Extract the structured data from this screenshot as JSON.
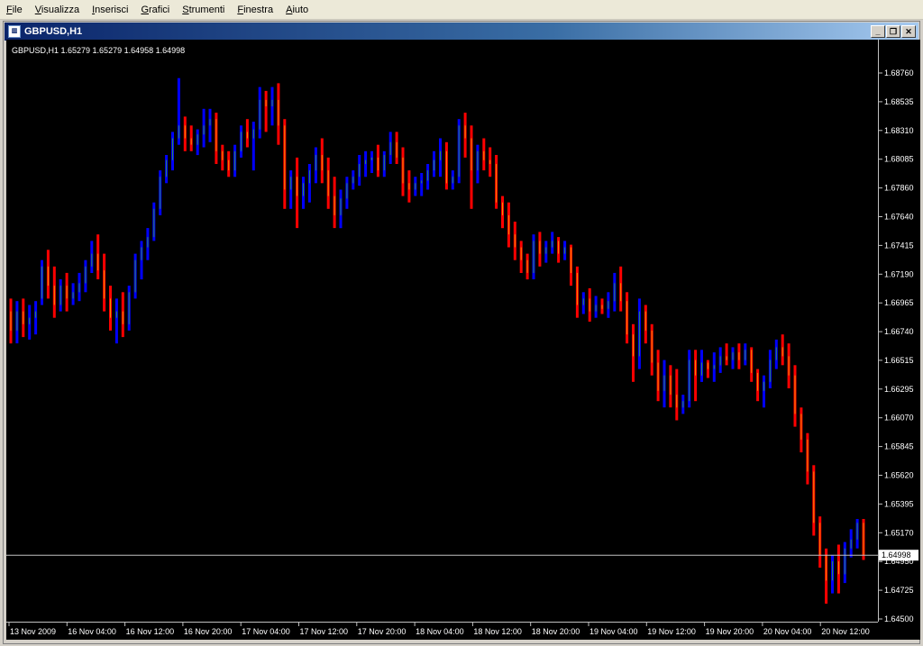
{
  "menu": {
    "items": [
      "File",
      "Visualizza",
      "Inserisci",
      "Grafici",
      "Strumenti",
      "Finestra",
      "Aiuto"
    ]
  },
  "window": {
    "title": "GBPUSD,H1",
    "icon": "chart-window-icon",
    "controls": [
      "minimize-icon",
      "restore-icon",
      "close-icon"
    ]
  },
  "colors": {
    "background": "#000000",
    "axis": "#c0c0c0",
    "label": "#ffffff",
    "bull_bar": "#0000ff",
    "bear_bar": "#ff0000",
    "bull_body": "#2e8b57",
    "bear_body": "#ff8c00",
    "bid_line": "#c0c0c0"
  },
  "chart_data": {
    "type": "bar",
    "symbol": "GBPUSD,H1",
    "info_line": "GBPUSD,H1  1.65279 1.65279 1.64958 1.64998",
    "current_price": "1.64998",
    "ylim": [
      1.645,
      1.69
    ],
    "y_ticks": [
      "1.68760",
      "1.68535",
      "1.68310",
      "1.68085",
      "1.67860",
      "1.67640",
      "1.67415",
      "1.67190",
      "1.66965",
      "1.66740",
      "1.66515",
      "1.66295",
      "1.66070",
      "1.65845",
      "1.65620",
      "1.65395",
      "1.65170",
      "1.64950",
      "1.64725",
      "1.64500"
    ],
    "x_ticks": [
      "13 Nov 2009",
      "16 Nov 04:00",
      "16 Nov 12:00",
      "16 Nov 20:00",
      "17 Nov 04:00",
      "17 Nov 12:00",
      "17 Nov 20:00",
      "18 Nov 04:00",
      "18 Nov 12:00",
      "18 Nov 20:00",
      "19 Nov 04:00",
      "19 Nov 12:00",
      "19 Nov 20:00",
      "20 Nov 04:00",
      "20 Nov 12:00"
    ],
    "bars": [
      [
        1.669,
        1.67,
        1.6665,
        1.6675
      ],
      [
        1.6675,
        1.6698,
        1.6665,
        1.669
      ],
      [
        1.669,
        1.67,
        1.667,
        1.668
      ],
      [
        1.668,
        1.6695,
        1.6668,
        1.6685
      ],
      [
        1.6685,
        1.6698,
        1.6672,
        1.669
      ],
      [
        1.67,
        1.673,
        1.6695,
        1.6725
      ],
      [
        1.6725,
        1.6738,
        1.67,
        1.671
      ],
      [
        1.671,
        1.6725,
        1.6685,
        1.6695
      ],
      [
        1.6695,
        1.6715,
        1.669,
        1.671
      ],
      [
        1.671,
        1.672,
        1.669,
        1.67
      ],
      [
        1.67,
        1.6712,
        1.6695,
        1.6705
      ],
      [
        1.6705,
        1.672,
        1.6698,
        1.6712
      ],
      [
        1.6712,
        1.673,
        1.6705,
        1.6725
      ],
      [
        1.6725,
        1.6745,
        1.672,
        1.6735
      ],
      [
        1.6735,
        1.675,
        1.6715,
        1.6722
      ],
      [
        1.6722,
        1.6735,
        1.669,
        1.67
      ],
      [
        1.67,
        1.671,
        1.6675,
        1.6685
      ],
      [
        1.6685,
        1.67,
        1.6665,
        1.669
      ],
      [
        1.669,
        1.6705,
        1.667,
        1.668
      ],
      [
        1.668,
        1.671,
        1.6675,
        1.6705
      ],
      [
        1.6705,
        1.6735,
        1.67,
        1.673
      ],
      [
        1.673,
        1.6745,
        1.6715,
        1.674
      ],
      [
        1.674,
        1.6755,
        1.673,
        1.6748
      ],
      [
        1.6748,
        1.6775,
        1.6745,
        1.677
      ],
      [
        1.677,
        1.68,
        1.6765,
        1.6795
      ],
      [
        1.6795,
        1.6812,
        1.679,
        1.6808
      ],
      [
        1.6808,
        1.683,
        1.68,
        1.6825
      ],
      [
        1.6825,
        1.6872,
        1.682,
        1.6835
      ],
      [
        1.6835,
        1.6842,
        1.6815,
        1.6825
      ],
      [
        1.6825,
        1.6835,
        1.6815,
        1.682
      ],
      [
        1.682,
        1.6832,
        1.6812,
        1.6828
      ],
      [
        1.6828,
        1.6848,
        1.6818,
        1.6835
      ],
      [
        1.6835,
        1.6848,
        1.6822,
        1.684
      ],
      [
        1.684,
        1.6845,
        1.6805,
        1.6815
      ],
      [
        1.6815,
        1.682,
        1.68,
        1.6808
      ],
      [
        1.6808,
        1.6815,
        1.6795,
        1.68
      ],
      [
        1.68,
        1.682,
        1.6795,
        1.6815
      ],
      [
        1.6815,
        1.6835,
        1.681,
        1.683
      ],
      [
        1.683,
        1.684,
        1.6818,
        1.6825
      ],
      [
        1.6825,
        1.6838,
        1.68,
        1.6832
      ],
      [
        1.6832,
        1.6865,
        1.6825,
        1.6855
      ],
      [
        1.6855,
        1.6862,
        1.683,
        1.685
      ],
      [
        1.685,
        1.6865,
        1.6835,
        1.6855
      ],
      [
        1.6855,
        1.6868,
        1.682,
        1.6835
      ],
      [
        1.6835,
        1.684,
        1.677,
        1.6785
      ],
      [
        1.6785,
        1.68,
        1.677,
        1.6795
      ],
      [
        1.6795,
        1.681,
        1.6755,
        1.678
      ],
      [
        1.678,
        1.6795,
        1.677,
        1.679
      ],
      [
        1.679,
        1.6805,
        1.6775,
        1.68
      ],
      [
        1.68,
        1.6818,
        1.679,
        1.6812
      ],
      [
        1.6812,
        1.6825,
        1.679,
        1.68
      ],
      [
        1.68,
        1.681,
        1.677,
        1.678
      ],
      [
        1.678,
        1.6795,
        1.6755,
        1.6765
      ],
      [
        1.6765,
        1.6785,
        1.6755,
        1.6778
      ],
      [
        1.6778,
        1.6795,
        1.677,
        1.679
      ],
      [
        1.679,
        1.68,
        1.6785,
        1.6795
      ],
      [
        1.6795,
        1.6812,
        1.6788,
        1.6805
      ],
      [
        1.6805,
        1.6815,
        1.6795,
        1.6808
      ],
      [
        1.6808,
        1.6815,
        1.6798,
        1.681
      ],
      [
        1.681,
        1.682,
        1.6795,
        1.68
      ],
      [
        1.68,
        1.6815,
        1.6795,
        1.6812
      ],
      [
        1.6812,
        1.683,
        1.6805,
        1.6822
      ],
      [
        1.6822,
        1.683,
        1.6805,
        1.681
      ],
      [
        1.681,
        1.6818,
        1.678,
        1.679
      ],
      [
        1.679,
        1.68,
        1.6775,
        1.6785
      ],
      [
        1.6785,
        1.6795,
        1.678,
        1.679
      ],
      [
        1.679,
        1.6798,
        1.678,
        1.6792
      ],
      [
        1.6792,
        1.6805,
        1.6785,
        1.68
      ],
      [
        1.68,
        1.6815,
        1.6795,
        1.6808
      ],
      [
        1.6808,
        1.6825,
        1.6795,
        1.6815
      ],
      [
        1.6815,
        1.6822,
        1.6785,
        1.679
      ],
      [
        1.679,
        1.68,
        1.6785,
        1.6795
      ],
      [
        1.6795,
        1.684,
        1.679,
        1.6835
      ],
      [
        1.6835,
        1.6845,
        1.681,
        1.6825
      ],
      [
        1.6825,
        1.6835,
        1.677,
        1.68
      ],
      [
        1.68,
        1.682,
        1.679,
        1.6815
      ],
      [
        1.6815,
        1.6825,
        1.68,
        1.6808
      ],
      [
        1.6808,
        1.6818,
        1.6795,
        1.6805
      ],
      [
        1.6805,
        1.6812,
        1.677,
        1.6775
      ],
      [
        1.6775,
        1.678,
        1.6755,
        1.6765
      ],
      [
        1.6765,
        1.6775,
        1.674,
        1.675
      ],
      [
        1.675,
        1.676,
        1.673,
        1.674
      ],
      [
        1.674,
        1.6745,
        1.672,
        1.673
      ],
      [
        1.673,
        1.6735,
        1.6715,
        1.672
      ],
      [
        1.672,
        1.675,
        1.6715,
        1.6745
      ],
      [
        1.6745,
        1.6752,
        1.6725,
        1.6735
      ],
      [
        1.6735,
        1.6745,
        1.6728,
        1.674
      ],
      [
        1.674,
        1.6752,
        1.6735,
        1.6745
      ],
      [
        1.6745,
        1.6748,
        1.6728,
        1.6735
      ],
      [
        1.6735,
        1.6745,
        1.673,
        1.674
      ],
      [
        1.674,
        1.6742,
        1.671,
        1.672
      ],
      [
        1.672,
        1.6725,
        1.6685,
        1.6695
      ],
      [
        1.6695,
        1.6705,
        1.6688,
        1.67
      ],
      [
        1.67,
        1.6708,
        1.6682,
        1.669
      ],
      [
        1.669,
        1.6702,
        1.6685,
        1.6695
      ],
      [
        1.6695,
        1.67,
        1.6688,
        1.6692
      ],
      [
        1.6692,
        1.6705,
        1.6685,
        1.6698
      ],
      [
        1.6698,
        1.672,
        1.669,
        1.6712
      ],
      [
        1.6712,
        1.6725,
        1.669,
        1.6698
      ],
      [
        1.6698,
        1.6705,
        1.6665,
        1.6672
      ],
      [
        1.6672,
        1.668,
        1.6635,
        1.6655
      ],
      [
        1.6655,
        1.67,
        1.6645,
        1.669
      ],
      [
        1.669,
        1.6695,
        1.6665,
        1.6675
      ],
      [
        1.6675,
        1.668,
        1.664,
        1.665
      ],
      [
        1.665,
        1.666,
        1.662,
        1.6628
      ],
      [
        1.6628,
        1.6652,
        1.6615,
        1.664
      ],
      [
        1.664,
        1.6648,
        1.6615,
        1.6625
      ],
      [
        1.6625,
        1.6645,
        1.6605,
        1.6615
      ],
      [
        1.6615,
        1.6625,
        1.661,
        1.662
      ],
      [
        1.662,
        1.666,
        1.6615,
        1.6652
      ],
      [
        1.6652,
        1.666,
        1.662,
        1.664
      ],
      [
        1.664,
        1.666,
        1.6635,
        1.665
      ],
      [
        1.665,
        1.6652,
        1.6638,
        1.6645
      ],
      [
        1.6645,
        1.6658,
        1.6635,
        1.6648
      ],
      [
        1.6648,
        1.6662,
        1.6642,
        1.6655
      ],
      [
        1.6655,
        1.6665,
        1.6648,
        1.6652
      ],
      [
        1.6652,
        1.6662,
        1.6645,
        1.6658
      ],
      [
        1.6658,
        1.6665,
        1.6645,
        1.6652
      ],
      [
        1.6652,
        1.6665,
        1.6648,
        1.666
      ],
      [
        1.666,
        1.6662,
        1.6635,
        1.6642
      ],
      [
        1.6642,
        1.6645,
        1.662,
        1.6628
      ],
      [
        1.6628,
        1.664,
        1.6615,
        1.6635
      ],
      [
        1.6635,
        1.666,
        1.663,
        1.6652
      ],
      [
        1.6652,
        1.6668,
        1.6645,
        1.6662
      ],
      [
        1.6662,
        1.6672,
        1.6648,
        1.6655
      ],
      [
        1.6655,
        1.6665,
        1.663,
        1.664
      ],
      [
        1.664,
        1.6648,
        1.66,
        1.661
      ],
      [
        1.661,
        1.6615,
        1.658,
        1.659
      ],
      [
        1.659,
        1.6595,
        1.6555,
        1.6565
      ],
      [
        1.6565,
        1.657,
        1.6515,
        1.6525
      ],
      [
        1.6525,
        1.653,
        1.649,
        1.65
      ],
      [
        1.65,
        1.6505,
        1.6462,
        1.648
      ],
      [
        1.648,
        1.65,
        1.647,
        1.6495
      ],
      [
        1.6495,
        1.6508,
        1.647,
        1.6485
      ],
      [
        1.6485,
        1.651,
        1.6478,
        1.6505
      ],
      [
        1.6505,
        1.652,
        1.6498,
        1.6512
      ],
      [
        1.6512,
        1.6528,
        1.6505,
        1.6525
      ],
      [
        1.6525,
        1.6528,
        1.6496,
        1.65
      ]
    ]
  }
}
